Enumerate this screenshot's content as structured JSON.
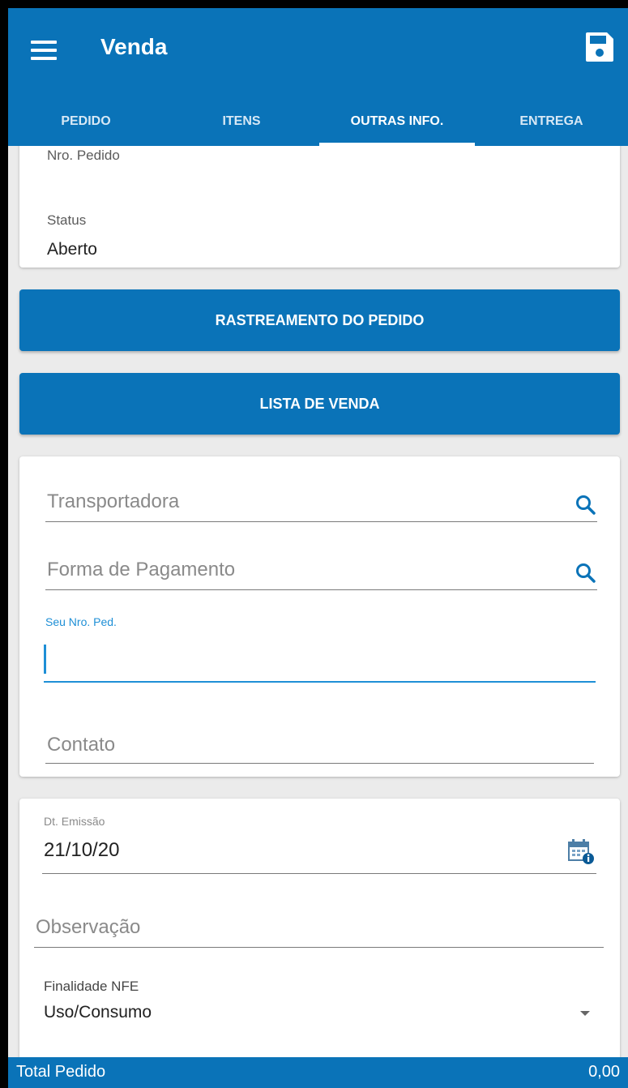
{
  "header": {
    "title": "Venda",
    "menu_icon": "hamburger-menu-icon",
    "save_icon": "floppy-disk-icon",
    "color": "#0a73b8"
  },
  "tabs": [
    {
      "label": "PEDIDO",
      "active": false
    },
    {
      "label": "ITENS",
      "active": false
    },
    {
      "label": "OUTRAS INFO.",
      "active": true
    },
    {
      "label": "ENTREGA",
      "active": false
    }
  ],
  "order_info": {
    "nro_pedido_label": "Nro. Pedido",
    "status_label": "Status",
    "status_value": "Aberto"
  },
  "buttons": {
    "tracking": "RASTREAMENTO DO PEDIDO",
    "sales_list": "LISTA DE VENDA"
  },
  "form": {
    "transportadora_placeholder": "Transportadora",
    "forma_pagamento_placeholder": "Forma de Pagamento",
    "seu_nro_ped_label": "Seu Nro. Ped.",
    "seu_nro_ped_value": "",
    "contato_placeholder": "Contato"
  },
  "details": {
    "dt_emissao_label": "Dt. Emissão",
    "dt_emissao_value": "21/10/20",
    "observacao_placeholder": "Observação",
    "finalidade_label": "Finalidade NFE",
    "finalidade_value": "Uso/Consumo"
  },
  "footer": {
    "total_label": "Total Pedido",
    "total_value": "0,00"
  }
}
